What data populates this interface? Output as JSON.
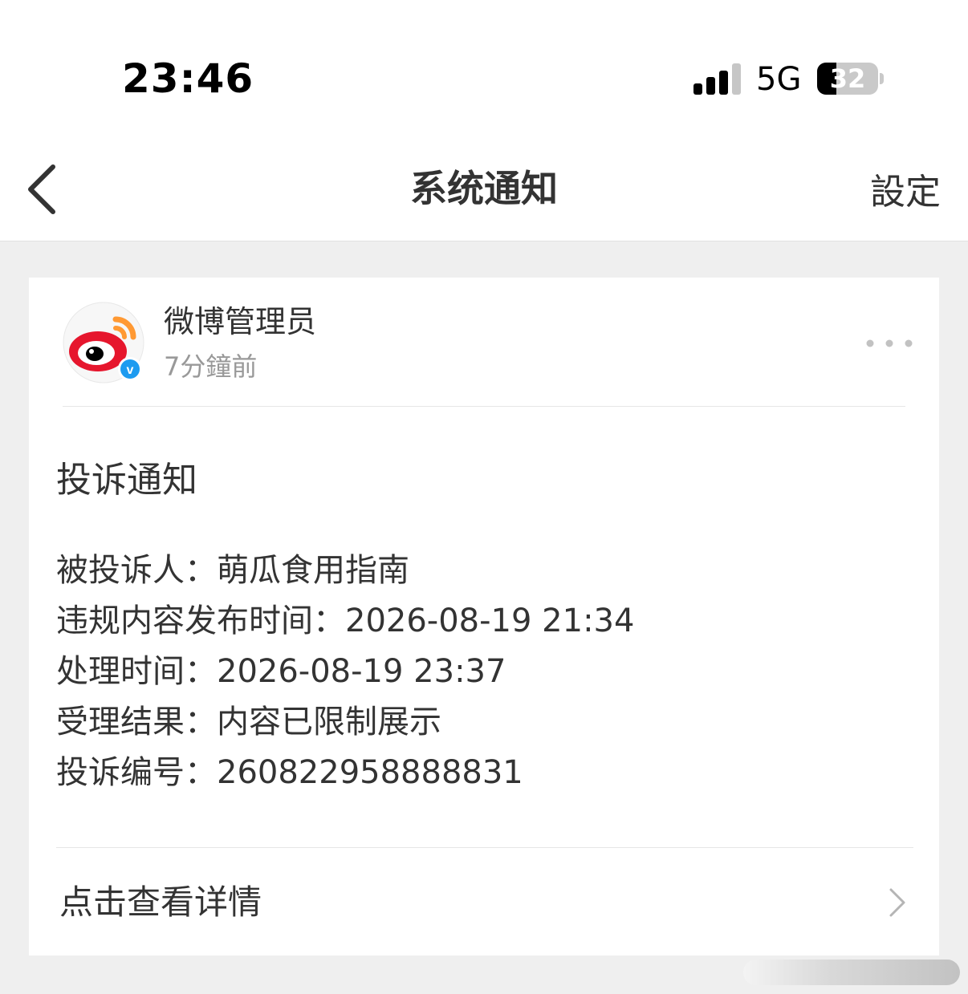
{
  "status_bar": {
    "time": "23:46",
    "network": "5G",
    "battery_level": "32",
    "battery_percent": 32,
    "signal_bars_active": 3,
    "signal_bars_total": 4
  },
  "nav": {
    "title": "系统通知",
    "settings_label": "設定",
    "back_icon": "chevron-left-icon"
  },
  "message": {
    "sender": "微博管理员",
    "time_ago": "7分鐘前",
    "avatar_icon": "weibo-logo",
    "verified_badge": "v",
    "more_icon": "more-horizontal-icon",
    "title": "投诉通知",
    "details": [
      "被投诉人：萌瓜食用指南",
      "违规内容发布时间：2026-08-19 21:34",
      "处理时间：2026-08-19 23:37",
      "受理结果：内容已限制展示",
      "投诉编号：260822958888831"
    ],
    "view_details_label": "点击查看详情",
    "view_details_icon": "chevron-right-icon"
  },
  "colors": {
    "background": "#efefef",
    "card": "#ffffff",
    "text_primary": "#333333",
    "text_secondary": "#999999",
    "weibo_red": "#e6162d",
    "weibo_orange": "#ff9933",
    "verified_blue": "#1d9bf0"
  }
}
